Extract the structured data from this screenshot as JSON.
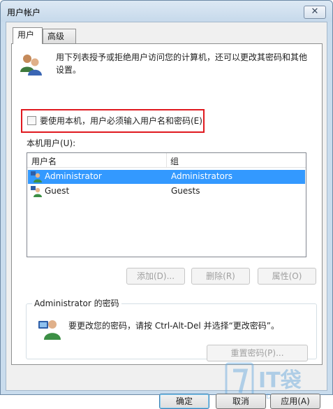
{
  "window": {
    "title": "用户帐户",
    "close_glyph": "✕"
  },
  "tabs": [
    {
      "label": "用户"
    },
    {
      "label": "高级"
    }
  ],
  "intro_text": "用下列表授予或拒绝用户访问您的计算机，还可以更改其密码和其他设置。",
  "checkbox": {
    "label": "要使用本机，用户必须输入用户名和密码(E)",
    "checked": false
  },
  "local_users_label": "本机用户(U):",
  "table": {
    "columns": [
      "用户名",
      "组"
    ],
    "rows": [
      {
        "user": "Administrator",
        "group": "Administrators",
        "selected": true
      },
      {
        "user": "Guest",
        "group": "Guests",
        "selected": false
      }
    ]
  },
  "list_buttons": {
    "add": "添加(D)...",
    "delete": "删除(R)",
    "properties": "属性(O)"
  },
  "password_group": {
    "title": "Administrator 的密码",
    "text": "要更改您的密码，请按 Ctrl-Alt-Del 并选择“更改密码”。",
    "reset_button": "重置密码(P)..."
  },
  "dialog_buttons": {
    "ok": "确定",
    "cancel": "取消",
    "apply": "应用(A)"
  },
  "watermark": {
    "brand": "IT袋",
    "site": "ITDAI.COM"
  },
  "colors": {
    "highlight_box": "#e0191f",
    "selection": "#3399ff"
  }
}
